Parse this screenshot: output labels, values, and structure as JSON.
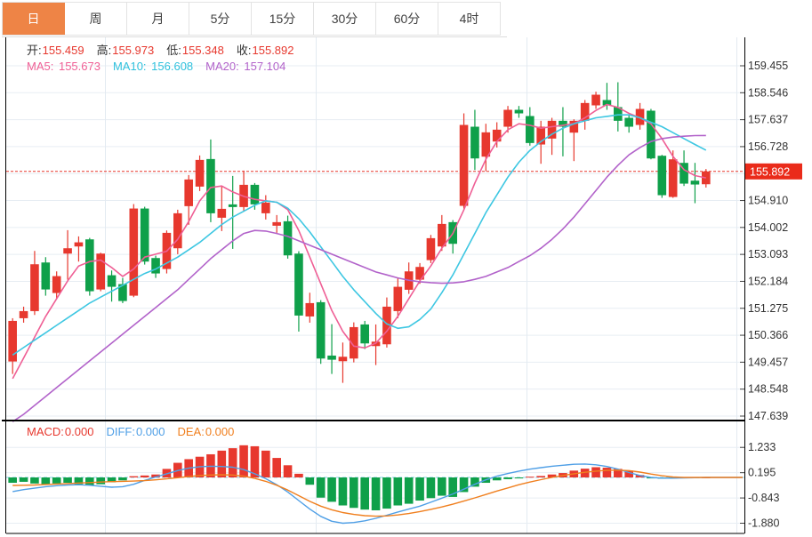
{
  "tabs": {
    "items": [
      {
        "id": "day",
        "label": "日",
        "active": true
      },
      {
        "id": "week",
        "label": "周",
        "active": false
      },
      {
        "id": "month",
        "label": "月",
        "active": false
      },
      {
        "id": "5min",
        "label": "5分",
        "active": false
      },
      {
        "id": "15min",
        "label": "15分",
        "active": false
      },
      {
        "id": "30min",
        "label": "30分",
        "active": false
      },
      {
        "id": "60min",
        "label": "60分",
        "active": false
      },
      {
        "id": "4hour",
        "label": "4时",
        "active": false
      }
    ]
  },
  "quote": {
    "open_label": "开:",
    "open": "155.459",
    "high_label": "高:",
    "high": "155.973",
    "low_label": "低:",
    "low": "155.348",
    "close_label": "收:",
    "close": "155.892"
  },
  "ma_row": {
    "ma5_label": "MA5:",
    "ma5": "155.673",
    "ma10_label": "MA10:",
    "ma10": "156.608",
    "ma20_label": "MA20:",
    "ma20": "157.104"
  },
  "macd_row": {
    "macd_label": "MACD:",
    "macd": "0.000",
    "diff_label": "DIFF:",
    "diff": "0.000",
    "dea_label": "DEA:",
    "dea": "0.000"
  },
  "colors": {
    "up": "#e7382e",
    "down": "#0fa04a",
    "tab_active": "#ee8446",
    "badge": "#ea2b1a",
    "ma5": "#ef5f95",
    "ma10": "#3ec7e2",
    "ma20": "#b263ca",
    "diff": "#4f9fe6",
    "dea": "#f07f1e",
    "grid": "#e7edf3",
    "vgrid": "#e3eaf1",
    "axis_text": "#333333",
    "zero_dash": "#86d3e8",
    "dashed_price": "#e7382e",
    "border": "#000000"
  },
  "chart_data": {
    "type": "candlestick",
    "title": "",
    "legend_position": "top-left-overlay",
    "grid": true,
    "price_axis": {
      "side": "right",
      "grid_prices": [
        159.455,
        158.546,
        157.637,
        156.728,
        155.819,
        154.91,
        154.002,
        153.093,
        152.184,
        151.275,
        150.366,
        149.457,
        148.548,
        147.639
      ],
      "grid_labels": [
        "159.455",
        "158.546",
        "157.637",
        "156.728",
        "",
        "154.910",
        "154.002",
        "153.093",
        "152.184",
        "151.275",
        "150.366",
        "149.457",
        "148.548",
        "147.639"
      ],
      "current_price": 155.892,
      "current_label": "155.892",
      "ylim": [
        147.2,
        159.9
      ]
    },
    "candles_ohlc": [
      [
        149.48,
        150.94,
        149.06,
        150.85
      ],
      [
        150.94,
        151.33,
        150.79,
        151.18
      ],
      [
        151.18,
        153.21,
        151.05,
        152.76
      ],
      [
        152.82,
        153.0,
        151.7,
        151.91
      ],
      [
        151.79,
        152.52,
        151.61,
        152.36
      ],
      [
        153.12,
        153.91,
        152.24,
        153.3
      ],
      [
        153.36,
        153.7,
        152.85,
        153.5
      ],
      [
        153.6,
        153.65,
        151.7,
        151.85
      ],
      [
        151.91,
        153.15,
        151.85,
        153.12
      ],
      [
        152.39,
        152.55,
        151.5,
        152.0
      ],
      [
        152.09,
        152.3,
        151.45,
        151.52
      ],
      [
        151.7,
        154.79,
        151.65,
        154.64
      ],
      [
        154.64,
        154.7,
        152.75,
        152.85
      ],
      [
        152.97,
        153.05,
        152.3,
        152.45
      ],
      [
        152.6,
        153.9,
        152.45,
        153.82
      ],
      [
        153.3,
        154.6,
        153.1,
        154.48
      ],
      [
        154.72,
        155.77,
        154.09,
        155.62
      ],
      [
        155.38,
        156.43,
        155.23,
        156.28
      ],
      [
        156.31,
        156.97,
        154.18,
        154.48
      ],
      [
        154.33,
        155.38,
        153.88,
        154.63
      ],
      [
        154.78,
        155.74,
        153.28,
        154.69
      ],
      [
        154.69,
        155.92,
        154.54,
        155.44
      ],
      [
        155.44,
        155.5,
        154.6,
        154.78
      ],
      [
        154.48,
        155.09,
        154.27,
        154.84
      ],
      [
        154.06,
        154.42,
        153.82,
        154.18
      ],
      [
        154.21,
        154.4,
        152.95,
        153.06
      ],
      [
        153.12,
        153.2,
        150.49,
        151.03
      ],
      [
        151.0,
        151.8,
        150.79,
        151.45
      ],
      [
        151.48,
        151.55,
        149.4,
        149.58
      ],
      [
        149.68,
        150.74,
        149.06,
        149.54
      ],
      [
        149.49,
        150.12,
        148.76,
        149.64
      ],
      [
        149.58,
        150.8,
        149.45,
        150.64
      ],
      [
        150.73,
        150.85,
        149.9,
        150.09
      ],
      [
        150.0,
        150.73,
        149.36,
        150.15
      ],
      [
        150.06,
        151.64,
        149.95,
        151.33
      ],
      [
        151.18,
        152.3,
        150.94,
        152.0
      ],
      [
        151.9,
        152.82,
        151.76,
        152.52
      ],
      [
        152.24,
        152.8,
        152.1,
        152.67
      ],
      [
        152.9,
        153.75,
        152.8,
        153.64
      ],
      [
        153.36,
        154.42,
        153.21,
        154.12
      ],
      [
        154.18,
        154.25,
        153.12,
        153.45
      ],
      [
        154.73,
        157.85,
        154.64,
        157.46
      ],
      [
        157.4,
        157.97,
        155.94,
        156.33
      ],
      [
        156.39,
        157.5,
        155.9,
        157.21
      ],
      [
        156.9,
        157.55,
        156.7,
        157.3
      ],
      [
        157.4,
        158.1,
        157.2,
        157.97
      ],
      [
        157.97,
        158.1,
        157.7,
        157.85
      ],
      [
        157.76,
        158.06,
        156.76,
        156.85
      ],
      [
        156.8,
        157.6,
        156.15,
        157.4
      ],
      [
        157.0,
        157.7,
        156.45,
        157.6
      ],
      [
        157.6,
        158.06,
        156.4,
        157.4
      ],
      [
        157.2,
        157.65,
        156.24,
        157.6
      ],
      [
        157.6,
        158.3,
        157.3,
        158.2
      ],
      [
        158.12,
        158.58,
        158.0,
        158.48
      ],
      [
        158.3,
        158.88,
        157.97,
        158.12
      ],
      [
        158.06,
        158.9,
        157.24,
        157.6
      ],
      [
        157.7,
        157.8,
        157.2,
        157.4
      ],
      [
        157.46,
        158.2,
        157.3,
        158.0
      ],
      [
        157.94,
        158.0,
        156.3,
        156.33
      ],
      [
        156.42,
        156.45,
        155.0,
        155.09
      ],
      [
        155.03,
        156.6,
        155.0,
        156.3
      ],
      [
        156.18,
        156.6,
        155.4,
        155.48
      ],
      [
        155.58,
        156.18,
        154.82,
        155.45
      ],
      [
        155.459,
        155.973,
        155.348,
        155.892
      ]
    ],
    "series": [
      {
        "name": "MA5",
        "values": [
          148.9,
          149.6,
          150.3,
          151.0,
          151.6,
          152.2,
          152.7,
          152.85,
          152.9,
          152.65,
          152.35,
          152.6,
          153.0,
          153.1,
          153.2,
          153.6,
          154.2,
          154.9,
          155.35,
          155.4,
          155.2,
          155.05,
          154.95,
          154.9,
          154.85,
          154.6,
          153.9,
          153.0,
          152.1,
          151.2,
          150.5,
          150.0,
          149.94,
          150.1,
          150.5,
          151.0,
          151.6,
          152.2,
          152.7,
          153.3,
          153.8,
          154.6,
          155.5,
          156.3,
          156.9,
          157.3,
          157.5,
          157.45,
          157.35,
          157.4,
          157.45,
          157.5,
          157.7,
          157.95,
          158.15,
          158.05,
          157.85,
          157.7,
          157.5,
          157.0,
          156.4,
          155.95,
          155.75,
          155.673
        ]
      },
      {
        "name": "MA10",
        "values": [
          149.7,
          149.95,
          150.2,
          150.45,
          150.7,
          150.95,
          151.2,
          151.45,
          151.65,
          151.85,
          152.05,
          152.25,
          152.45,
          152.6,
          152.8,
          153.0,
          153.25,
          153.5,
          153.8,
          154.1,
          154.35,
          154.55,
          154.75,
          154.9,
          154.85,
          154.65,
          154.3,
          153.85,
          153.35,
          152.85,
          152.35,
          151.9,
          151.5,
          151.1,
          150.75,
          150.6,
          150.65,
          150.9,
          151.25,
          151.8,
          152.4,
          153.1,
          153.8,
          154.5,
          155.1,
          155.7,
          156.2,
          156.6,
          156.9,
          157.15,
          157.35,
          157.5,
          157.6,
          157.7,
          157.75,
          157.8,
          157.8,
          157.7,
          157.55,
          157.4,
          157.2,
          157.0,
          156.8,
          156.608
        ]
      },
      {
        "name": "MA20",
        "values": [
          147.45,
          147.7,
          148.0,
          148.3,
          148.6,
          148.9,
          149.2,
          149.5,
          149.8,
          150.1,
          150.4,
          150.7,
          151.0,
          151.3,
          151.6,
          151.9,
          152.25,
          152.6,
          152.95,
          153.25,
          153.55,
          153.8,
          153.9,
          153.88,
          153.8,
          153.7,
          153.55,
          153.4,
          153.25,
          153.1,
          152.95,
          152.8,
          152.65,
          152.5,
          152.4,
          152.3,
          152.22,
          152.17,
          152.14,
          152.12,
          152.13,
          152.17,
          152.25,
          152.35,
          152.5,
          152.65,
          152.85,
          153.05,
          153.3,
          153.6,
          153.95,
          154.35,
          154.8,
          155.25,
          155.7,
          156.1,
          156.45,
          156.7,
          156.9,
          157.0,
          157.05,
          157.08,
          157.1,
          157.104
        ]
      }
    ],
    "macd": {
      "axis_values": [
        1.233,
        0.195,
        -0.843,
        -1.88
      ],
      "axis_labels": [
        "1.233",
        "0.195",
        "-0.843",
        "-1.880"
      ],
      "hist": [
        -0.22,
        -0.18,
        -0.25,
        -0.28,
        -0.25,
        -0.22,
        -0.28,
        -0.32,
        -0.28,
        -0.2,
        -0.12,
        0.05,
        0.08,
        0.12,
        0.35,
        0.6,
        0.75,
        0.85,
        0.95,
        1.1,
        1.2,
        1.32,
        1.28,
        1.1,
        0.8,
        0.5,
        0.15,
        -0.3,
        -0.83,
        -1.0,
        -1.15,
        -1.25,
        -1.32,
        -1.35,
        -1.28,
        -1.15,
        -1.08,
        -0.95,
        -0.85,
        -0.75,
        -0.8,
        -0.6,
        -0.38,
        -0.22,
        -0.12,
        -0.07,
        -0.04,
        0.03,
        0.06,
        0.12,
        0.18,
        0.28,
        0.36,
        0.42,
        0.4,
        0.35,
        0.28,
        0.1,
        -0.04,
        -0.05,
        -0.04,
        -0.03,
        -0.02,
        0.0
      ],
      "diff": [
        -0.58,
        -0.5,
        -0.44,
        -0.38,
        -0.34,
        -0.31,
        -0.3,
        -0.32,
        -0.36,
        -0.4,
        -0.38,
        -0.28,
        -0.12,
        0.02,
        0.15,
        0.28,
        0.38,
        0.44,
        0.46,
        0.45,
        0.42,
        0.32,
        0.15,
        -0.05,
        -0.3,
        -0.6,
        -0.95,
        -1.3,
        -1.6,
        -1.8,
        -1.88,
        -1.85,
        -1.78,
        -1.68,
        -1.55,
        -1.42,
        -1.3,
        -1.18,
        -1.02,
        -0.85,
        -0.68,
        -0.48,
        -0.28,
        -0.1,
        0.05,
        0.16,
        0.26,
        0.34,
        0.4,
        0.46,
        0.5,
        0.54,
        0.55,
        0.52,
        0.45,
        0.34,
        0.2,
        0.08,
        0.0,
        -0.03,
        -0.03,
        -0.02,
        -0.01,
        0.0
      ],
      "dea": [
        -0.33,
        -0.32,
        -0.31,
        -0.29,
        -0.27,
        -0.25,
        -0.23,
        -0.21,
        -0.19,
        -0.17,
        -0.16,
        -0.15,
        -0.13,
        -0.1,
        -0.06,
        -0.01,
        0.04,
        0.08,
        0.1,
        0.11,
        0.1,
        0.05,
        -0.04,
        -0.16,
        -0.32,
        -0.52,
        -0.75,
        -0.98,
        -1.18,
        -1.33,
        -1.44,
        -1.52,
        -1.57,
        -1.59,
        -1.58,
        -1.54,
        -1.48,
        -1.4,
        -1.31,
        -1.21,
        -1.1,
        -0.97,
        -0.84,
        -0.7,
        -0.56,
        -0.43,
        -0.3,
        -0.19,
        -0.09,
        0.0,
        0.08,
        0.15,
        0.21,
        0.26,
        0.29,
        0.3,
        0.28,
        0.22,
        0.14,
        0.07,
        0.02,
        0.0,
        0.0,
        0.0
      ]
    }
  }
}
